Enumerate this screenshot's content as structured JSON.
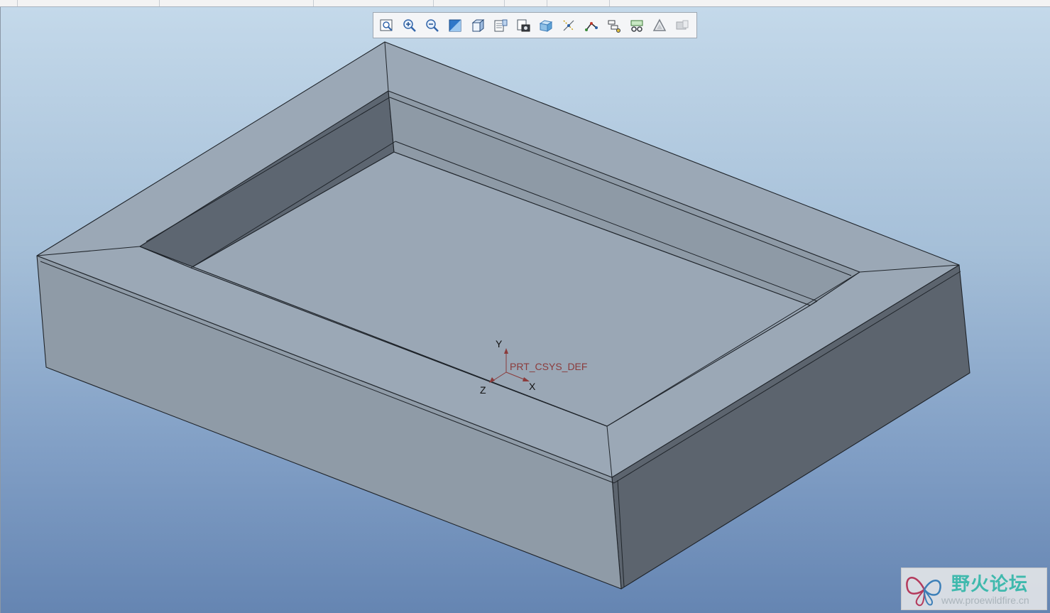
{
  "window": {
    "top_tabs_visible": false
  },
  "graphics_toolbar": {
    "buttons": [
      {
        "name": "refit-icon"
      },
      {
        "name": "zoom-in-icon"
      },
      {
        "name": "zoom-out-icon"
      },
      {
        "name": "repaint-icon"
      },
      {
        "name": "display-style-icon"
      },
      {
        "name": "saved-views-icon"
      },
      {
        "name": "view-manager-icon"
      },
      {
        "name": "section-icon"
      },
      {
        "name": "datum-display-icon"
      },
      {
        "name": "annotation-display-icon"
      },
      {
        "name": "layer-icon"
      },
      {
        "name": "model-tree-icon"
      },
      {
        "name": "appearance-icon"
      },
      {
        "name": "extra-tool-icon"
      }
    ]
  },
  "model": {
    "coordinate_system": {
      "name": "PRT_CSYS_DEF",
      "axis_x": "X",
      "axis_y": "Y",
      "axis_z": "Z"
    },
    "colors": {
      "rim_top": "#9ba8b6",
      "inner_wall_dark": "#5d6671",
      "inner_wall_light": "#8e9aa6",
      "floor": "#9aa7b5",
      "front_face": "#8f9ba7",
      "right_face": "#5c646e",
      "csys_label": "#8b3b3b"
    }
  },
  "watermark": {
    "title": "野火论坛",
    "url": "www.proewildfire.cn"
  }
}
